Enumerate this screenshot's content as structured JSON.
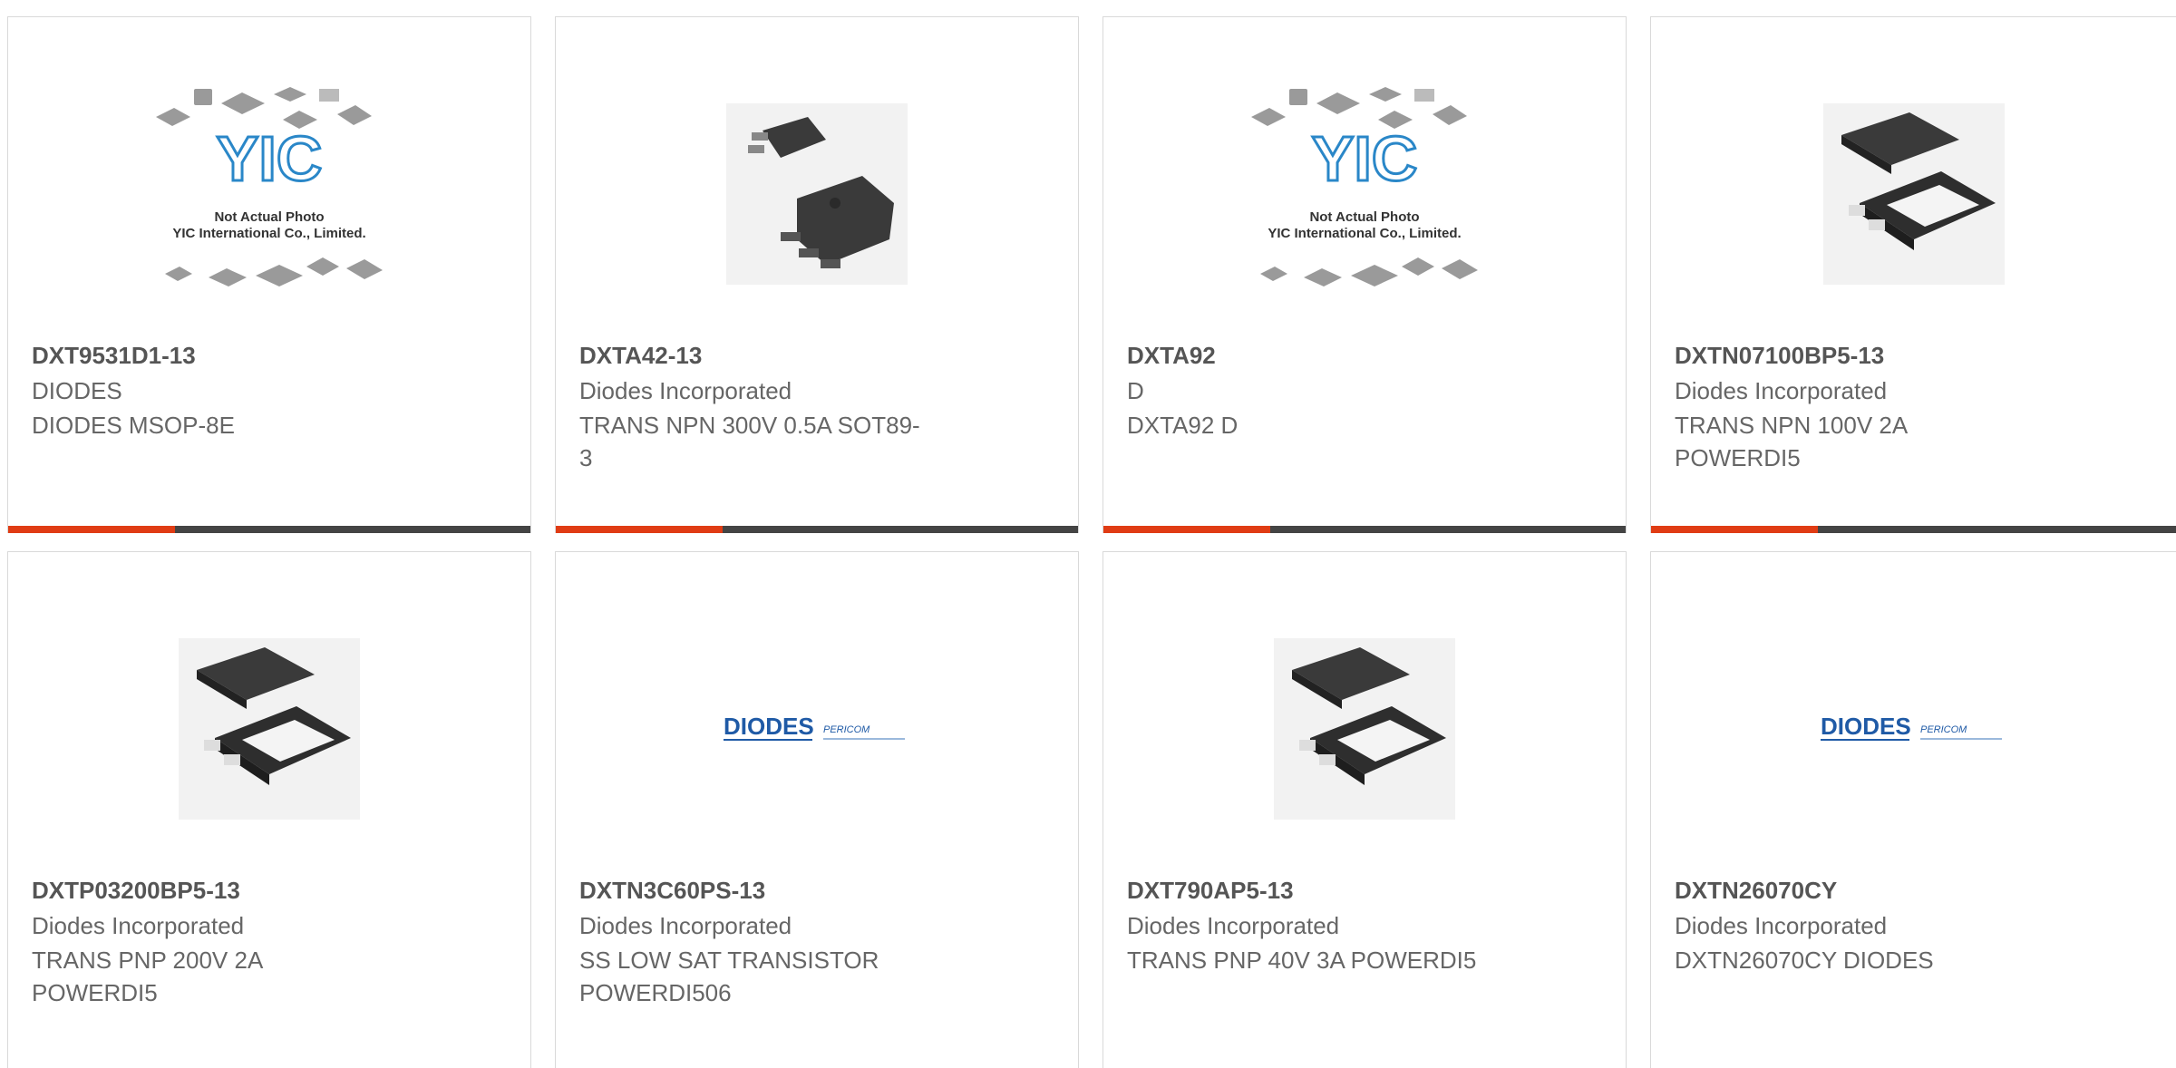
{
  "colors": {
    "accent": "#e03c14",
    "bar": "#444444",
    "border": "#d9d9d9"
  },
  "placeholder": {
    "line1": "Not Actual Photo",
    "line2": "YIC International Co., Limited.",
    "logo": "YIC"
  },
  "diodes_logo": {
    "brand": "DIODES",
    "sub": "PERICOM"
  },
  "cards": [
    {
      "part": "DXT9531D1-13",
      "mfr": "DIODES",
      "desc": "DIODES MSOP-8E",
      "image": "yic-placeholder"
    },
    {
      "part": "DXTA42-13",
      "mfr": "Diodes Incorporated",
      "desc": "TRANS NPN 300V 0.5A SOT89-\n3",
      "image": "sot89-package"
    },
    {
      "part": "DXTA92",
      "mfr": "D",
      "desc": "DXTA92 D",
      "image": "yic-placeholder"
    },
    {
      "part": "DXTN07100BP5-13",
      "mfr": "Diodes Incorporated",
      "desc": "TRANS NPN 100V 2A\nPOWERDI5",
      "image": "powerdi5-package"
    },
    {
      "part": "DXTP03200BP5-13",
      "mfr": "Diodes Incorporated",
      "desc": "TRANS PNP 200V 2A\nPOWERDI5",
      "image": "powerdi5-package"
    },
    {
      "part": "DXTN3C60PS-13",
      "mfr": "Diodes Incorporated",
      "desc": "SS LOW SAT TRANSISTOR\nPOWERDI506",
      "image": "diodes-logo"
    },
    {
      "part": "DXT790AP5-13",
      "mfr": "Diodes Incorporated",
      "desc": "TRANS PNP 40V 3A POWERDI5",
      "image": "powerdi5-package"
    },
    {
      "part": "DXTN26070CY",
      "mfr": "Diodes Incorporated",
      "desc": "DXTN26070CY DIODES",
      "image": "diodes-logo"
    }
  ]
}
